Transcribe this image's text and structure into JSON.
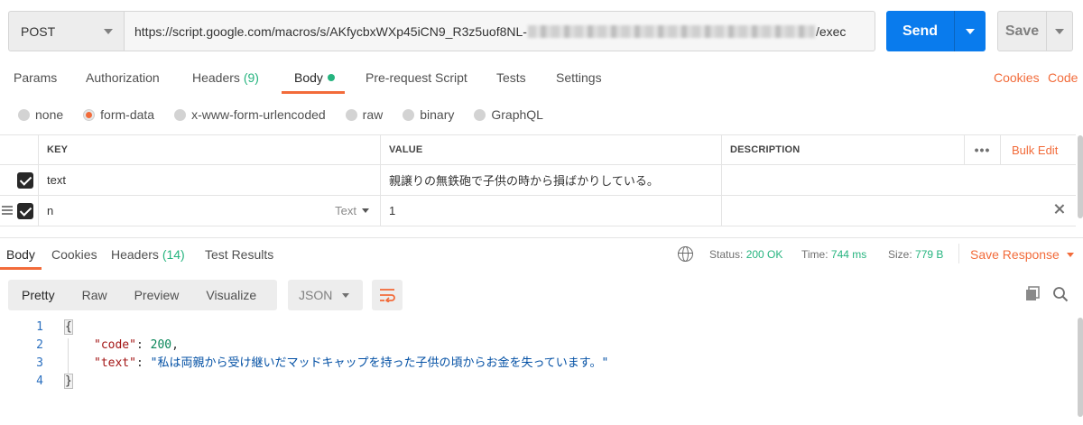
{
  "request": {
    "method": "POST",
    "url_prefix": "https://script.google.com/macros/s/AKfycbxWXp45iCN9_R3z5uof8NL-",
    "url_suffix": "/exec",
    "send_label": "Send",
    "save_label": "Save"
  },
  "request_tabs": {
    "params": "Params",
    "authorization": "Authorization",
    "headers": "Headers",
    "headers_count": "(9)",
    "body": "Body",
    "prerequest": "Pre-request Script",
    "tests": "Tests",
    "settings": "Settings",
    "cookies": "Cookies",
    "code": "Code"
  },
  "body_types": {
    "none": "none",
    "form_data": "form-data",
    "urlencoded": "x-www-form-urlencoded",
    "raw": "raw",
    "binary": "binary",
    "graphql": "GraphQL",
    "selected": "form-data"
  },
  "params_table": {
    "headers": {
      "key": "KEY",
      "value": "VALUE",
      "description": "DESCRIPTION",
      "more": "•••",
      "bulk_edit": "Bulk Edit"
    },
    "rows": [
      {
        "checked": true,
        "key": "text",
        "value": "親譲りの無鉄砲で子供の時から損ばかりしている。",
        "description": ""
      },
      {
        "checked": true,
        "key": "n",
        "type": "Text",
        "value": "1",
        "description": ""
      }
    ]
  },
  "response_tabs": {
    "body": "Body",
    "cookies": "Cookies",
    "headers": "Headers",
    "headers_count": "(14)",
    "test_results": "Test Results"
  },
  "response_status": {
    "status_label": "Status:",
    "status_value": "200 OK",
    "time_label": "Time:",
    "time_value": "744 ms",
    "size_label": "Size:",
    "size_value": "779 B",
    "save_response": "Save Response"
  },
  "view_modes": {
    "pretty": "Pretty",
    "raw": "Raw",
    "preview": "Preview",
    "visualize": "Visualize",
    "format": "JSON"
  },
  "response_body": {
    "line_numbers": [
      "1",
      "2",
      "3",
      "4"
    ],
    "open_brace": "{",
    "close_brace": "}",
    "code_key": "\"code\"",
    "code_value": "200",
    "text_key": "\"text\"",
    "text_value": "\"私は両親から受け継いだマッドキャップを持った子供の頃からお金を失っています。\""
  },
  "colors": {
    "accent": "#f26b3a",
    "send_blue": "#097bed",
    "success_green": "#26b47f"
  }
}
